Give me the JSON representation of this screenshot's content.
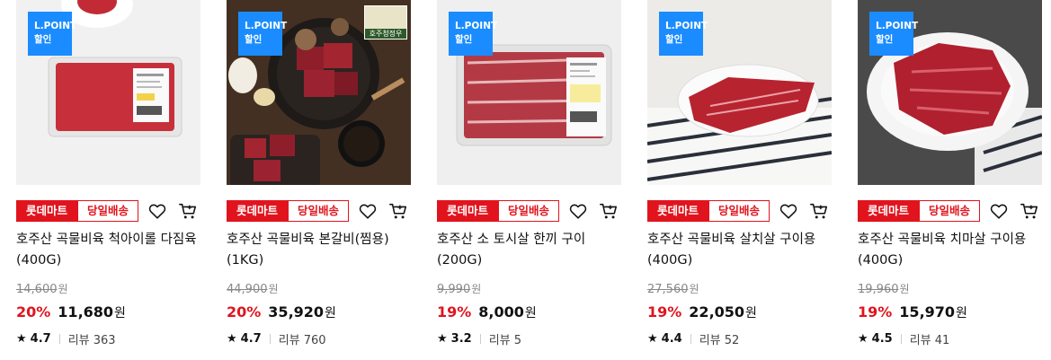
{
  "badges": {
    "store": "롯데마트",
    "delivery": "당일배송",
    "promo_line1": "L.POINT",
    "promo_line2": "할인",
    "origin_label": "호주청정우"
  },
  "colors": {
    "accent": "#e1141e",
    "promo": "#1a8cff"
  },
  "icons": {
    "wish": "heart-icon",
    "cart": "cart-icon",
    "rating": "star-icon"
  },
  "products": [
    {
      "title": "호주산 곡물비육 척아이롤 다짐육 (400G)",
      "original_price": "14,600",
      "price_unit": "원",
      "discount": "20%",
      "price": "11,680",
      "currency": "원",
      "rating": "4.7",
      "reviews": "리뷰 363"
    },
    {
      "title": "호주산 곡물비육 본갈비(찜용) (1KG)",
      "original_price": "44,900",
      "price_unit": "원",
      "discount": "20%",
      "price": "35,920",
      "currency": "원",
      "rating": "4.7",
      "reviews": "리뷰 760"
    },
    {
      "title": "호주산 소 토시살 한끼 구이 (200G)",
      "original_price": "9,990",
      "price_unit": "원",
      "discount": "19%",
      "price": "8,000",
      "currency": "원",
      "rating": "3.2",
      "reviews": "리뷰 5"
    },
    {
      "title": "호주산 곡물비육 살치살 구이용 (400G)",
      "original_price": "27,560",
      "price_unit": "원",
      "discount": "19%",
      "price": "22,050",
      "currency": "원",
      "rating": "4.4",
      "reviews": "리뷰 52"
    },
    {
      "title": "호주산 곡물비육 치마살 구이용 (400G)",
      "original_price": "19,960",
      "price_unit": "원",
      "discount": "19%",
      "price": "15,970",
      "currency": "원",
      "rating": "4.5",
      "reviews": "리뷰 41"
    }
  ]
}
